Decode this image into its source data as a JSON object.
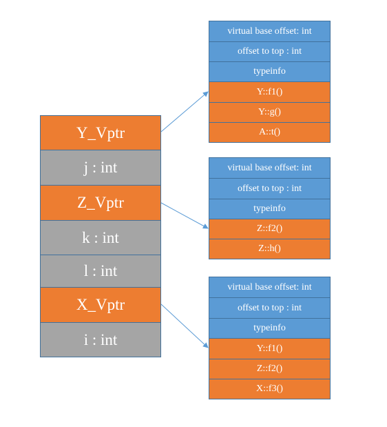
{
  "object_layout": [
    {
      "label": "Y_Vptr",
      "kind": "vptr"
    },
    {
      "label": "j : int",
      "kind": "field"
    },
    {
      "label": "Z_Vptr",
      "kind": "vptr"
    },
    {
      "label": "k : int",
      "kind": "field"
    },
    {
      "label": "l : int",
      "kind": "field"
    },
    {
      "label": "X_Vptr",
      "kind": "vptr"
    },
    {
      "label": "i : int",
      "kind": "field"
    }
  ],
  "vtables": [
    {
      "from": "Y_Vptr",
      "entries": [
        {
          "label": "virtual base offset: int",
          "kind": "meta"
        },
        {
          "label": "offset to top : int",
          "kind": "meta"
        },
        {
          "label": "typeinfo",
          "kind": "meta"
        },
        {
          "label": "Y::f1()",
          "kind": "func"
        },
        {
          "label": "Y::g()",
          "kind": "func"
        },
        {
          "label": "A::t()",
          "kind": "func"
        }
      ]
    },
    {
      "from": "Z_Vptr",
      "entries": [
        {
          "label": "virtual base offset: int",
          "kind": "meta"
        },
        {
          "label": "offset to top : int",
          "kind": "meta"
        },
        {
          "label": "typeinfo",
          "kind": "meta"
        },
        {
          "label": "Z::f2()",
          "kind": "func"
        },
        {
          "label": "Z::h()",
          "kind": "func"
        }
      ]
    },
    {
      "from": "X_Vptr",
      "entries": [
        {
          "label": "virtual base offset: int",
          "kind": "meta"
        },
        {
          "label": "offset to top : int",
          "kind": "meta"
        },
        {
          "label": "typeinfo",
          "kind": "meta"
        },
        {
          "label": "Y::f1()",
          "kind": "func"
        },
        {
          "label": "Z::f2()",
          "kind": "func"
        },
        {
          "label": "X::f3()",
          "kind": "func"
        }
      ]
    }
  ],
  "colors": {
    "vptr": "#ED7D31",
    "field": "#A5A5A5",
    "meta": "#5B9BD5",
    "func": "#ED7D31",
    "border": "#41719C",
    "arrow": "#5B9BD5"
  }
}
